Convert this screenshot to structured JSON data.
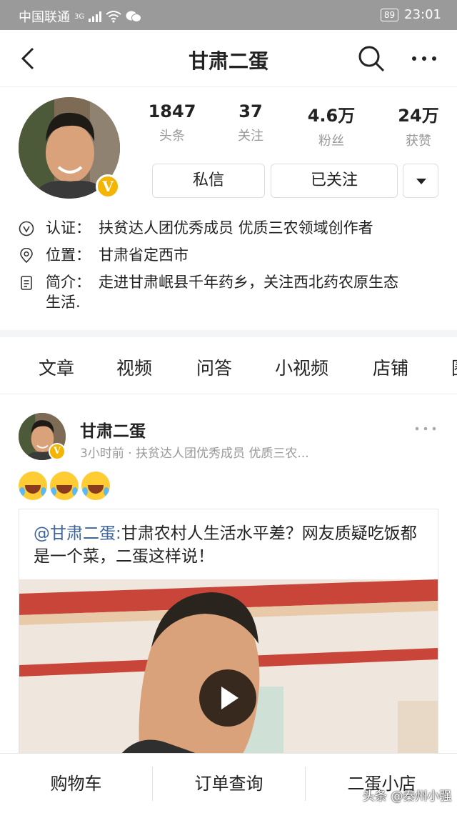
{
  "status_bar": {
    "carrier": "中国联通",
    "network": "3G",
    "battery": "89",
    "time": "23:01"
  },
  "header": {
    "title": "甘肃二蛋"
  },
  "profile": {
    "stats": [
      {
        "value": "1847",
        "label": "头条"
      },
      {
        "value": "37",
        "label": "关注"
      },
      {
        "value": "4.6万",
        "label": "粉丝"
      },
      {
        "value": "24万",
        "label": "获赞"
      }
    ],
    "message_button": "私信",
    "follow_button": "已关注",
    "verified_badge": "V",
    "certification_label": "认证：",
    "certification": "扶贫达人团优秀成员 优质三农领域创作者",
    "location_label": "位置：",
    "location": "甘肃省定西市",
    "bio_label": "简介：",
    "bio_line1": "走进甘肃岷县千年药乡，关注西北药农原生态",
    "bio_line2": "生活."
  },
  "tabs": [
    "文章",
    "视频",
    "问答",
    "小视频",
    "店铺",
    "圈"
  ],
  "post": {
    "author": "甘肃二蛋",
    "meta": "3小时前 · 扶贫达人团优秀成员 优质三农...",
    "emoji_count": 3,
    "quote_mention": "@甘肃二蛋:",
    "quote_text": "甘肃农村人生活水平差？网友质疑吃饭都是一个菜，二蛋这样说！"
  },
  "bottom_bar": {
    "cart": "购物车",
    "orders": "订单查询",
    "shop": "二蛋小店"
  },
  "watermark": "头条 @秦州小强",
  "colors": {
    "status_bar": "#9a9a9a",
    "verified": "#f4b400",
    "mention": "#406599"
  }
}
